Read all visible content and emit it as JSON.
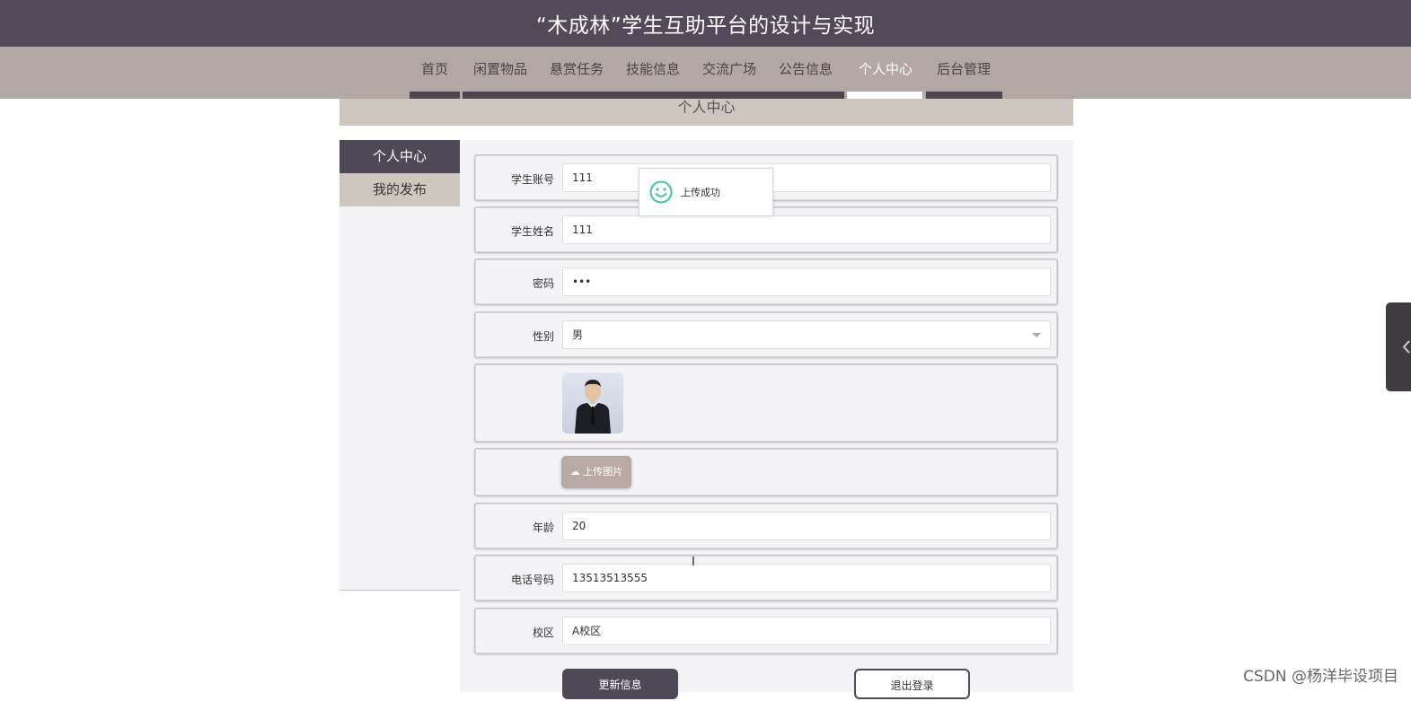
{
  "header": {
    "title": "“木成林”学生互助平台的设计与实现"
  },
  "nav": {
    "items": [
      {
        "label": "首页"
      },
      {
        "label": "闲置物品"
      },
      {
        "label": "悬赏任务"
      },
      {
        "label": "技能信息"
      },
      {
        "label": "交流广场"
      },
      {
        "label": "公告信息"
      },
      {
        "label": "个人中心",
        "active": true
      },
      {
        "label": "后台管理"
      }
    ]
  },
  "section": {
    "title": "个人中心"
  },
  "sidebar": {
    "items": [
      {
        "label": "个人中心",
        "active": true
      },
      {
        "label": "我的发布"
      }
    ]
  },
  "form": {
    "account": {
      "label": "学生账号",
      "value": "111"
    },
    "name": {
      "label": "学生姓名",
      "value": "111"
    },
    "password": {
      "label": "密码",
      "value": "•••"
    },
    "gender": {
      "label": "性别",
      "value": "男"
    },
    "upload_label": "上传图片",
    "age": {
      "label": "年龄",
      "value": "20"
    },
    "phone": {
      "label": "电话号码",
      "value": "13513513555"
    },
    "campus": {
      "label": "校区",
      "value": "A校区"
    }
  },
  "toast": {
    "message": "上传成功"
  },
  "buttons": {
    "update": "更新信息",
    "logout": "退出登录"
  },
  "watermark": "CSDN @杨洋毕设项目",
  "colors": {
    "header_bg": "#524a58",
    "nav_bg": "#b3a8a3",
    "accent_dark": "#4f4856",
    "accent_light": "#cec7bf",
    "success_icon": "#43c39a"
  }
}
